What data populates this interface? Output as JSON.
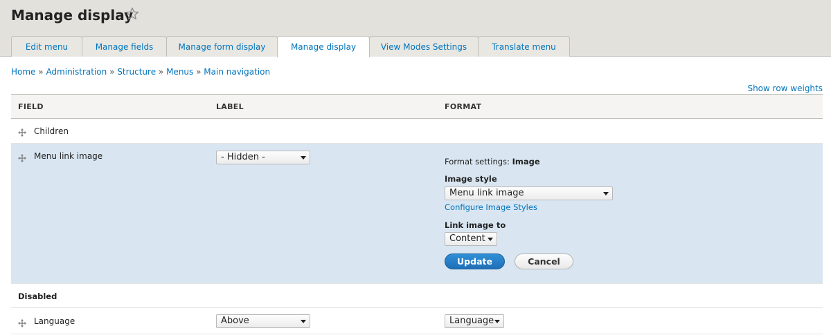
{
  "page": {
    "title": "Manage display",
    "star_icon": "star-outline-icon"
  },
  "tabs": [
    {
      "label": "Edit menu"
    },
    {
      "label": "Manage fields"
    },
    {
      "label": "Manage form display"
    },
    {
      "label": "Manage display",
      "active": true
    },
    {
      "label": "View Modes Settings"
    },
    {
      "label": "Translate menu"
    }
  ],
  "breadcrumb": {
    "items": [
      "Home",
      "Administration",
      "Structure",
      "Menus",
      "Main navigation"
    ],
    "separator": "»"
  },
  "show_row_weights": "Show row weights",
  "table": {
    "headers": {
      "field": "FIELD",
      "label": "LABEL",
      "format": "FORMAT"
    },
    "rows": {
      "children": {
        "field": "Children"
      },
      "menu_link_image": {
        "field": "Menu link image",
        "label_select": "- Hidden -",
        "format_settings_prefix": "Format settings:",
        "format_settings_name": "Image",
        "image_style_label": "Image style",
        "image_style_value": "Menu link image",
        "configure_link": "Configure Image Styles",
        "link_image_to_label": "Link image to",
        "link_image_to_value": "Content",
        "update_button": "Update",
        "cancel_button": "Cancel"
      },
      "disabled_region": {
        "label": "Disabled"
      },
      "language": {
        "field": "Language",
        "label_select": "Above",
        "format_select": "Language"
      }
    }
  },
  "colors": {
    "header_bg": "#e3e1db",
    "link": "#0074bd",
    "selected_row": "#d9e6f1",
    "primary_button": "#1f6fb8"
  }
}
